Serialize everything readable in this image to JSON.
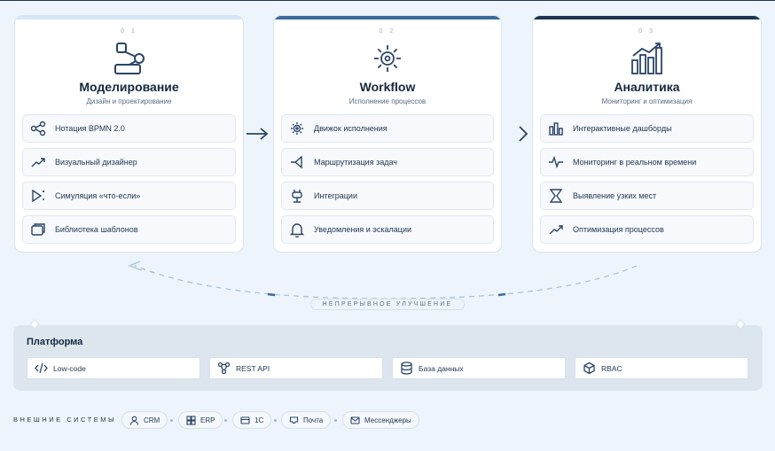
{
  "colors": {
    "accent1": "#d6e6f5",
    "accent2": "#3d6a9a",
    "accent3": "#1c3552",
    "icon": "#2a4566",
    "dashed": "#a9c3da"
  },
  "stages": [
    {
      "num": "0 1",
      "title": "Моделирование",
      "subtitle": "Дизайн и проектирование",
      "icon": "share-nodes-icon",
      "items": [
        {
          "label": "Нотация BPMN 2.0",
          "icon": "share-icon"
        },
        {
          "label": "Визуальный дизайнер",
          "icon": "trend-up-icon"
        },
        {
          "label": "Симуляция «что-если»",
          "icon": "play-sparkle-icon"
        },
        {
          "label": "Библиотека шаблонов",
          "icon": "layers-icon"
        }
      ]
    },
    {
      "num": "0 2",
      "title": "Workflow",
      "subtitle": "Исполнение процессов",
      "icon": "sun-engine-icon",
      "items": [
        {
          "label": "Движок исполнения",
          "icon": "gear-icon"
        },
        {
          "label": "Маршрутизация задач",
          "icon": "route-icon"
        },
        {
          "label": "Интеграции",
          "icon": "plug-icon"
        },
        {
          "label": "Уведомления и эскалации",
          "icon": "bell-icon"
        }
      ]
    },
    {
      "num": "0 3",
      "title": "Аналитика",
      "subtitle": "Мониторинг и оптимизация",
      "icon": "bar-chart-icon",
      "items": [
        {
          "label": "Интерактивные дашборды",
          "icon": "bars-icon"
        },
        {
          "label": "Мониторинг в реальном времени",
          "icon": "pulse-icon"
        },
        {
          "label": "Выявление узких мест",
          "icon": "hourglass-icon"
        },
        {
          "label": "Оптимизация процессов",
          "icon": "trend-up-icon"
        }
      ]
    }
  ],
  "loop_label": "НЕПРЕРЫВНОЕ УЛУЧШЕНИЕ",
  "platform": {
    "title": "Платформа",
    "items": [
      {
        "label": "Low-code",
        "icon": "code-icon"
      },
      {
        "label": "REST API",
        "icon": "api-icon"
      },
      {
        "label": "База данных",
        "icon": "database-icon"
      },
      {
        "label": "RBAC",
        "icon": "cube-icon"
      }
    ]
  },
  "external": {
    "label": "ВНЕШНИЕ СИСТЕМЫ",
    "items": [
      {
        "label": "CRM",
        "icon": "user-icon"
      },
      {
        "label": "ERP",
        "icon": "grid-icon"
      },
      {
        "label": "1С",
        "icon": "card-icon"
      },
      {
        "label": "Почта",
        "icon": "mail-tray-icon"
      },
      {
        "label": "Мессенджеры",
        "icon": "message-icon"
      }
    ]
  }
}
